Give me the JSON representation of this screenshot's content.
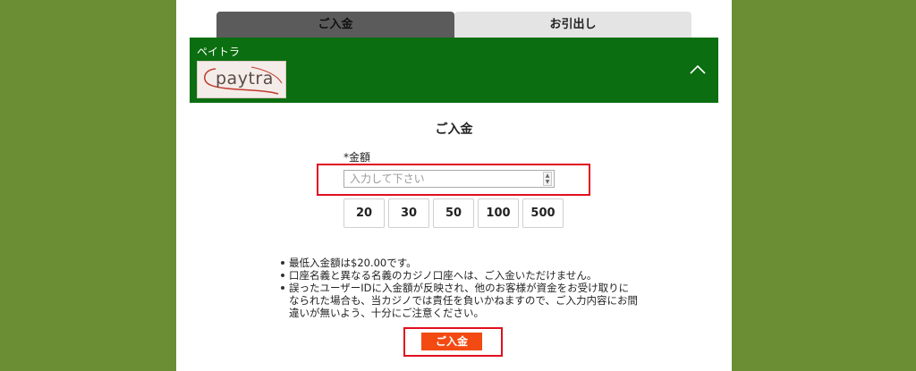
{
  "tabs": [
    {
      "label": "ご入金"
    },
    {
      "label": "お引出し"
    }
  ],
  "provider": {
    "name": "ペイトラ",
    "logo_text": "paytra"
  },
  "form": {
    "title": "ご入金",
    "amount_label": "*金額",
    "amount_placeholder": "入力して下さい",
    "quick_amounts": [
      "20",
      "30",
      "50",
      "100",
      "500"
    ],
    "notes": [
      "最低入金額は$20.00です。",
      "口座名義と異なる名義のカジノ口座へは、ご入金いただけません。",
      "誤ったユーザーIDに入金額が反映され、他のお客様が資金をお受け取りになられた場合も、当カジノでは責任を負いかねますので、ご入力内容にお間違いが無いよう、十分にご注意ください。"
    ],
    "submit_label": "ご入金"
  },
  "colors": {
    "page_background": "#6b8e35",
    "provider_bar": "#0b6e10",
    "highlight_frame": "#e10f1f",
    "submit_button": "#f24a12"
  }
}
